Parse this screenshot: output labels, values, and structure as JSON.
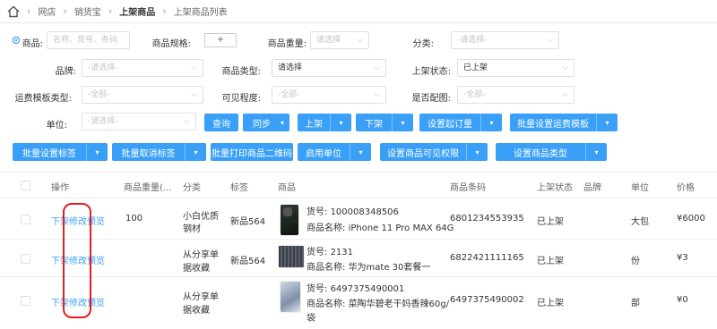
{
  "breadcrumb": [
    "网店",
    "销货宝",
    "上架商品",
    "上架商品列表"
  ],
  "filters": {
    "goods": {
      "label": "商品:",
      "placeholder": "名称、货号、条码"
    },
    "spec": {
      "label": "商品规格:",
      "value": "+"
    },
    "weight": {
      "label": "商品重量:",
      "value": "请选择"
    },
    "category": {
      "label": "分类:",
      "value": "-请选择-"
    },
    "brand": {
      "label": "品牌:",
      "value": "-请选择-"
    },
    "type": {
      "label": "商品类型:",
      "value": "请选择"
    },
    "status": {
      "label": "上架状态:",
      "value": "已上架"
    },
    "shipping_tpl": {
      "label": "运费模板类型:",
      "value": "-全部-"
    },
    "visibility": {
      "label": "可见程度:",
      "value": "-全部-"
    },
    "has_image": {
      "label": "是否配图:",
      "value": "-全部-"
    },
    "unit": {
      "label": "单位:",
      "value": "-请选择-"
    }
  },
  "buttons_row1": {
    "query": "查询",
    "sync": "同步",
    "on_shelf": "上架",
    "off_shelf": "下架",
    "set_min_order": "设置起订量",
    "batch_shipping": "批量设置运费模板"
  },
  "buttons_row2": {
    "batch_tag": "批量设置标签",
    "batch_untag": "批量取消标签",
    "batch_print_qr": "批量打印商品二维码",
    "enable_unit": "启用单位",
    "set_visibility": "设置商品可见权限",
    "set_type": "设置商品类型"
  },
  "table": {
    "headers": [
      "操作",
      "商品重量(...",
      "分类",
      "标签",
      "商品",
      "商品条码",
      "上架状态",
      "品牌",
      "单位",
      "价格"
    ],
    "actions": {
      "off": "下架",
      "edit": "修改",
      "preview": "预览"
    },
    "sku_prefix": "货号:",
    "name_prefix": "商品名称:",
    "rows": [
      {
        "weight": "100",
        "category": [
          "小白优质",
          "钢材"
        ],
        "tag": "新品564",
        "sku": "100008348506",
        "name": "iPhone 11 Pro MAX 64G",
        "barcode": "6801234553935",
        "status": "已上架",
        "brand": "",
        "unit": "大包",
        "price": "¥6000"
      },
      {
        "weight": "",
        "category": [
          "从分享单",
          "据收藏"
        ],
        "tag": "新品564",
        "sku": "2131",
        "name": "华为mate 30套餐一",
        "barcode": "6822421111165",
        "status": "已上架",
        "brand": "",
        "unit": "份",
        "price": "¥3"
      },
      {
        "weight": "",
        "category": [
          "从分享单",
          "据收藏"
        ],
        "tag": "",
        "sku": "6497375490001",
        "name": "菜陶华碧老干妈香辣60g/",
        "name2": "袋",
        "barcode": "6497375490002",
        "status": "已上架",
        "brand": "",
        "unit": "部",
        "price": "¥0"
      }
    ]
  }
}
